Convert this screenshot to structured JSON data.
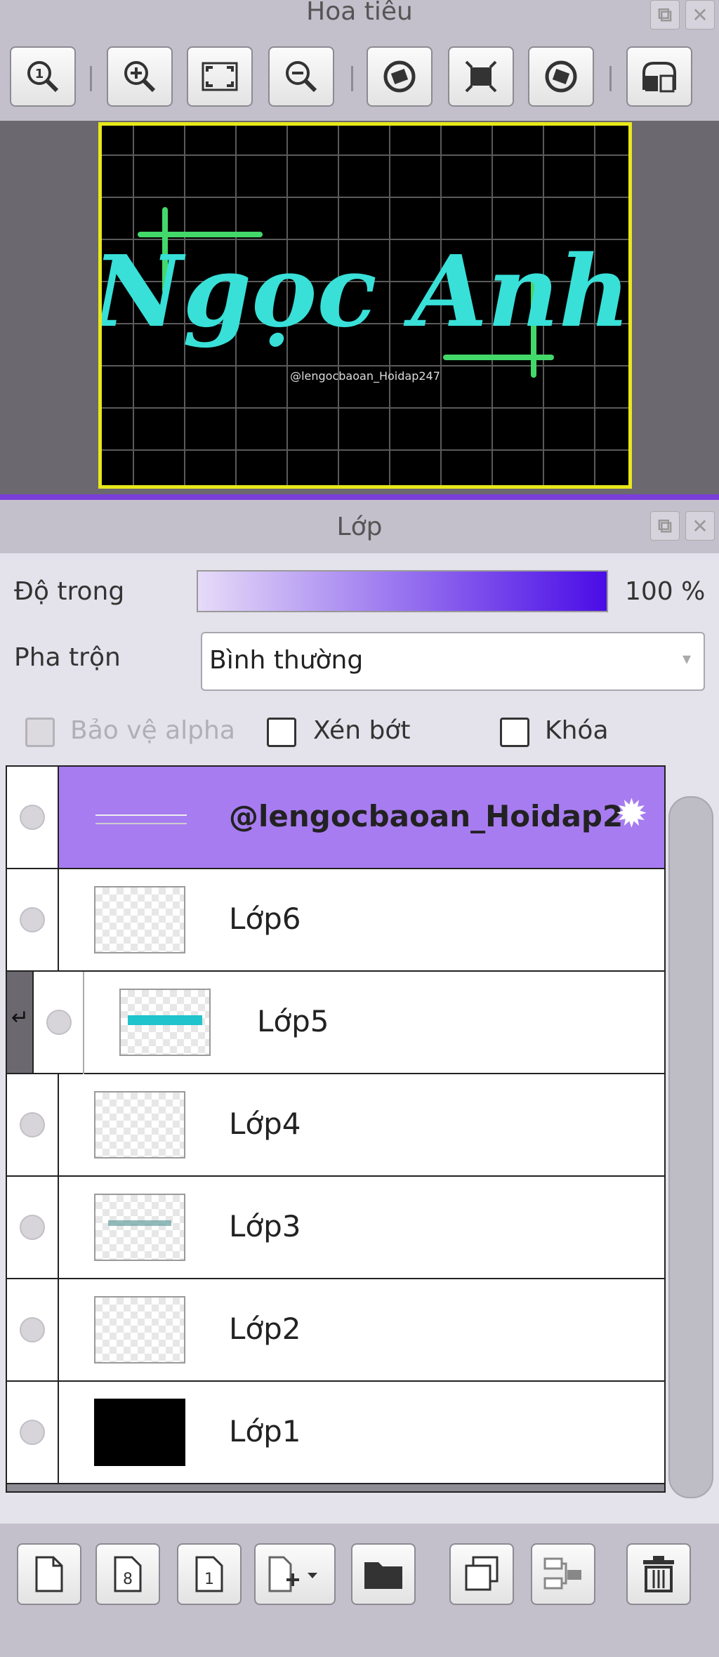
{
  "navigator": {
    "title": "Hoa tiêu",
    "preview_text": "Ngọc Anh",
    "watermark": "@lengocbaoan_Hoidap247"
  },
  "layers_panel": {
    "title": "Lớp",
    "opacity_label": "Độ trong",
    "opacity_value": "100 %",
    "opacity_percent": 100,
    "blend_label": "Pha trộn",
    "blend_value": "Bình thường",
    "protect_alpha_label": "Bảo vệ alpha",
    "clipping_label": "Xén bớt",
    "lock_label": "Khóa",
    "layers": [
      {
        "name": "@lengocbaoan_Hoidap2",
        "selected": true
      },
      {
        "name": "Lớp6"
      },
      {
        "name": "Lớp5",
        "clipped": true
      },
      {
        "name": "Lớp4"
      },
      {
        "name": "Lớp3"
      },
      {
        "name": "Lớp2"
      },
      {
        "name": "Lớp1"
      }
    ]
  },
  "colors": {
    "accent": "#7a3ed9",
    "selected_row": "#a77cf0",
    "frame": "#e8e81a"
  }
}
